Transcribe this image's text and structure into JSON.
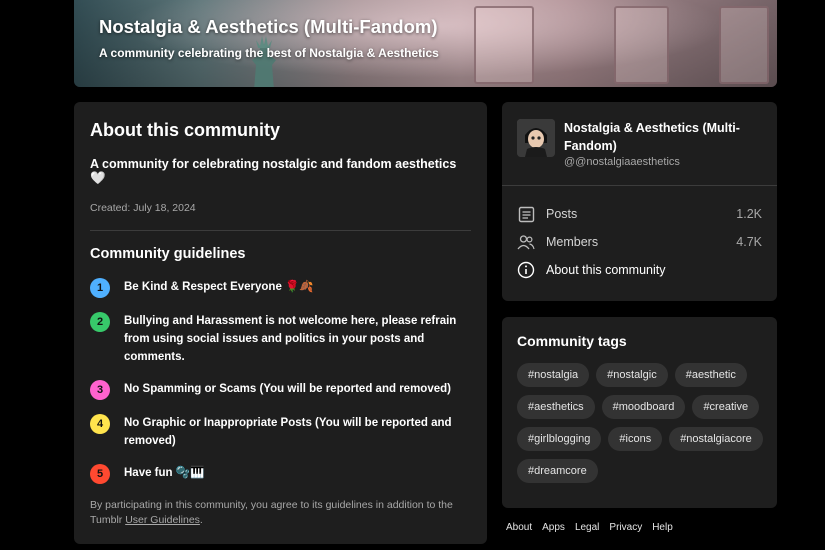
{
  "banner": {
    "title": "Nostalgia & Aesthetics (Multi-Fandom)",
    "subtitle": "A community celebrating the best of Nostalgia & Aesthetics"
  },
  "about": {
    "title": "About this community",
    "description": "A community for celebrating nostalgic and fandom aesthetics🤍",
    "created": "Created: July 18, 2024",
    "guidelines_title": "Community guidelines",
    "rules": [
      {
        "num": "1",
        "text": "Be Kind & Respect Everyone 🌹🍂",
        "color": "#4fb0ff"
      },
      {
        "num": "2",
        "text": "Bullying and Harassment is not welcome here, please refrain from using social issues and politics in your posts and comments.",
        "color": "#37c96a"
      },
      {
        "num": "3",
        "text": "No Spamming or Scams (You will be reported and removed)",
        "color": "#ff62ce"
      },
      {
        "num": "4",
        "text": "No Graphic or Inappropriate Posts (You will be reported and removed)",
        "color": "#ffe44d"
      },
      {
        "num": "5",
        "text": "Have fun 🫧🎹",
        "color": "#ff4930"
      }
    ],
    "agree_text": "By participating in this community, you agree to its guidelines in addition to the Tumblr ",
    "agree_link": "User Guidelines",
    "agree_end": "."
  },
  "profile": {
    "name": "Nostalgia & Aesthetics (Multi-Fandom)",
    "handle": "@@nostalgiaaesthetics",
    "posts_label": "Posts",
    "posts_value": "1.2K",
    "members_label": "Members",
    "members_value": "4.7K",
    "about_label": "About this community"
  },
  "tags": {
    "title": "Community tags",
    "items": [
      "#nostalgia",
      "#nostalgic",
      "#aesthetic",
      "#aesthetics",
      "#moodboard",
      "#creative",
      "#girlblogging",
      "#icons",
      "#nostalgiacore",
      "#dreamcore"
    ]
  },
  "footer": {
    "links": [
      "About",
      "Apps",
      "Legal",
      "Privacy",
      "Help"
    ]
  }
}
